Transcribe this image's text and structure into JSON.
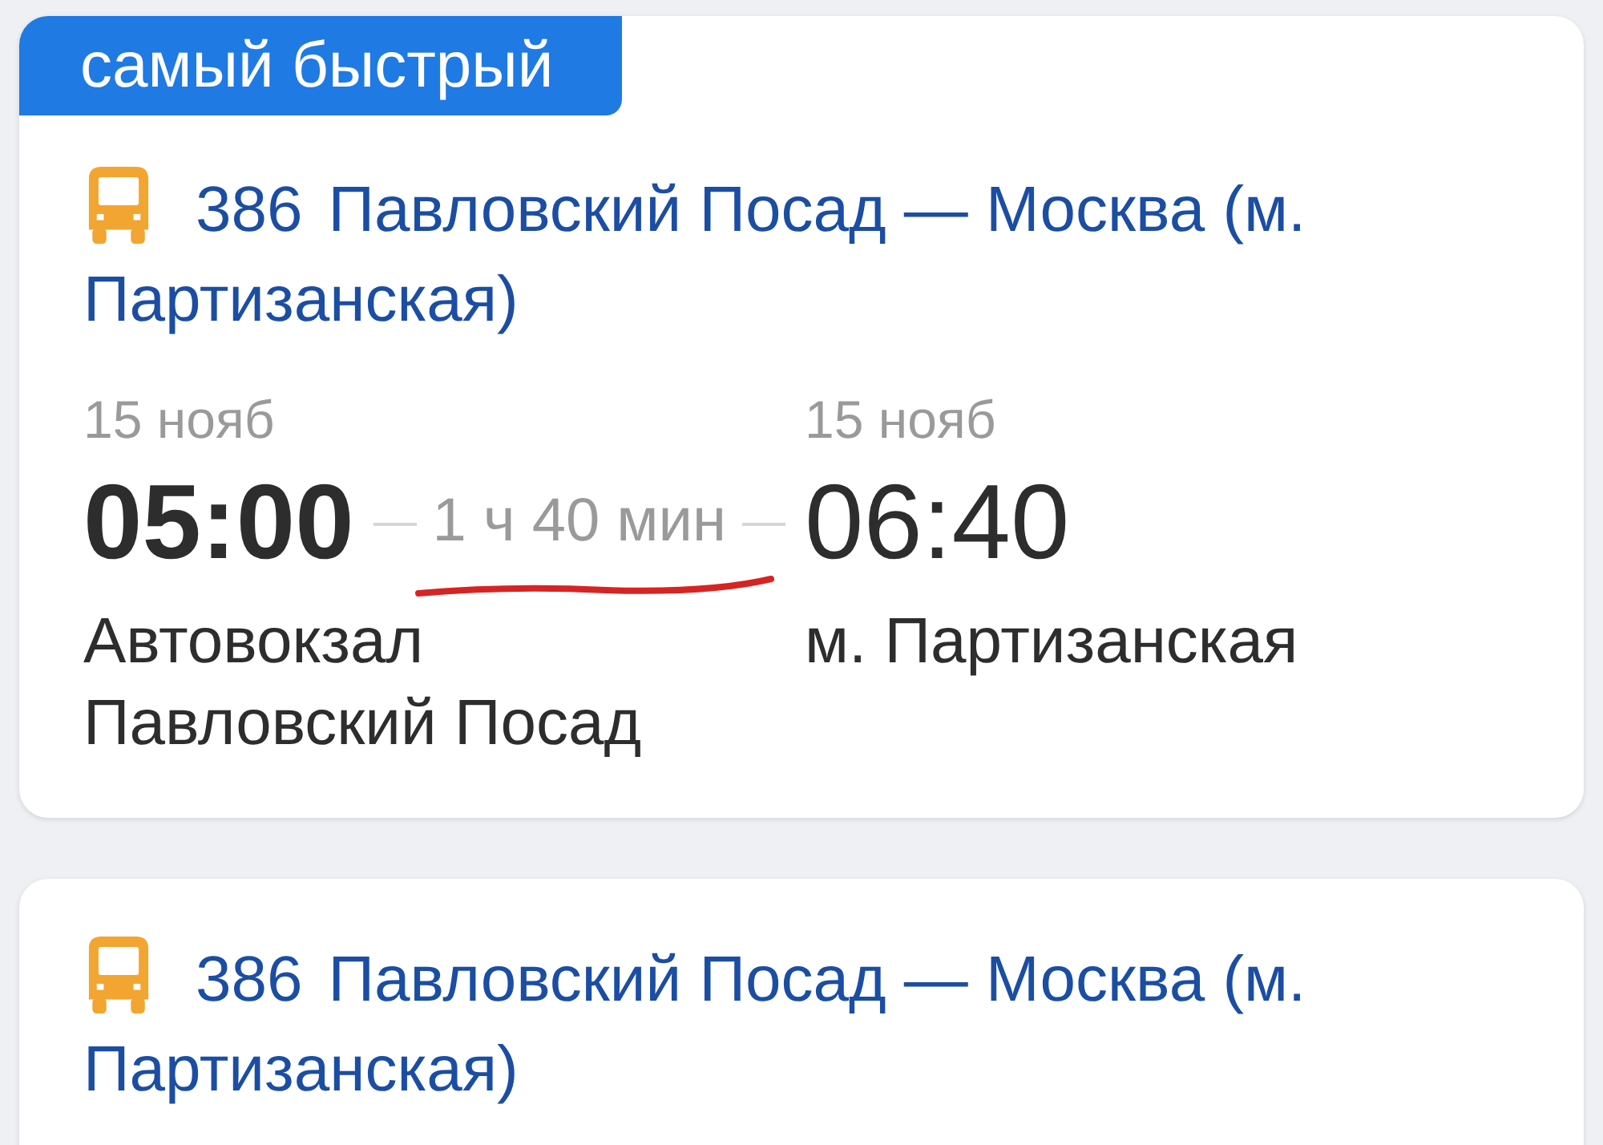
{
  "results": [
    {
      "badge": "самый быстрый",
      "route": {
        "kind": "bus",
        "number": "386",
        "name": "Павловский Посад — Москва (м. Партизанская)"
      },
      "departure": {
        "date": "15 нояб",
        "time": "05:00",
        "station": "Автовокзал Павловский Посад"
      },
      "duration": {
        "text": "1 ч 40 мин",
        "underlined": true
      },
      "arrival": {
        "date": "15 нояб",
        "time": "06:40",
        "station": "м. Партизанская"
      }
    },
    {
      "route": {
        "kind": "bus",
        "number": "386",
        "name": "Павловский Посад — Москва (м. Партизанская)"
      }
    }
  ]
}
